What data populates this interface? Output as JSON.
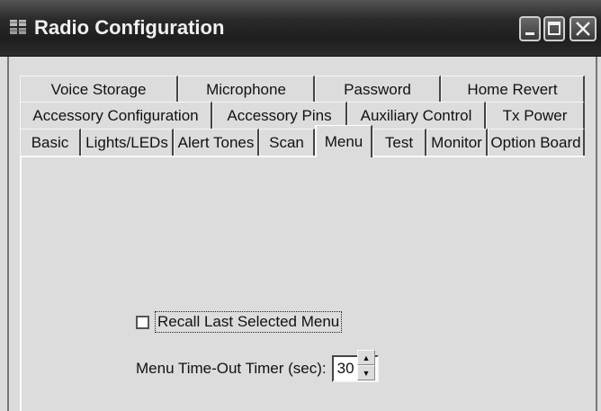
{
  "window": {
    "title": "Radio Configuration",
    "icon": "app-grid-icon",
    "controls": [
      "minimize-icon",
      "maximize-icon",
      "close-icon"
    ]
  },
  "tabs": {
    "row1": [
      "Voice Storage",
      "Microphone",
      "Password",
      "Home Revert"
    ],
    "row2": [
      "Accessory Configuration",
      "Accessory Pins",
      "Auxiliary Control",
      "Tx Power"
    ],
    "row3": [
      "Basic",
      "Lights/LEDs",
      "Alert Tones",
      "Scan",
      "Menu",
      "Test",
      "Monitor",
      "Option Board"
    ],
    "active": "Menu"
  },
  "menu_panel": {
    "recall_label": "Recall Last Selected Menu",
    "recall_checked": false,
    "timer_label": "Menu Time-Out Timer (sec):",
    "timer_value": "30"
  }
}
